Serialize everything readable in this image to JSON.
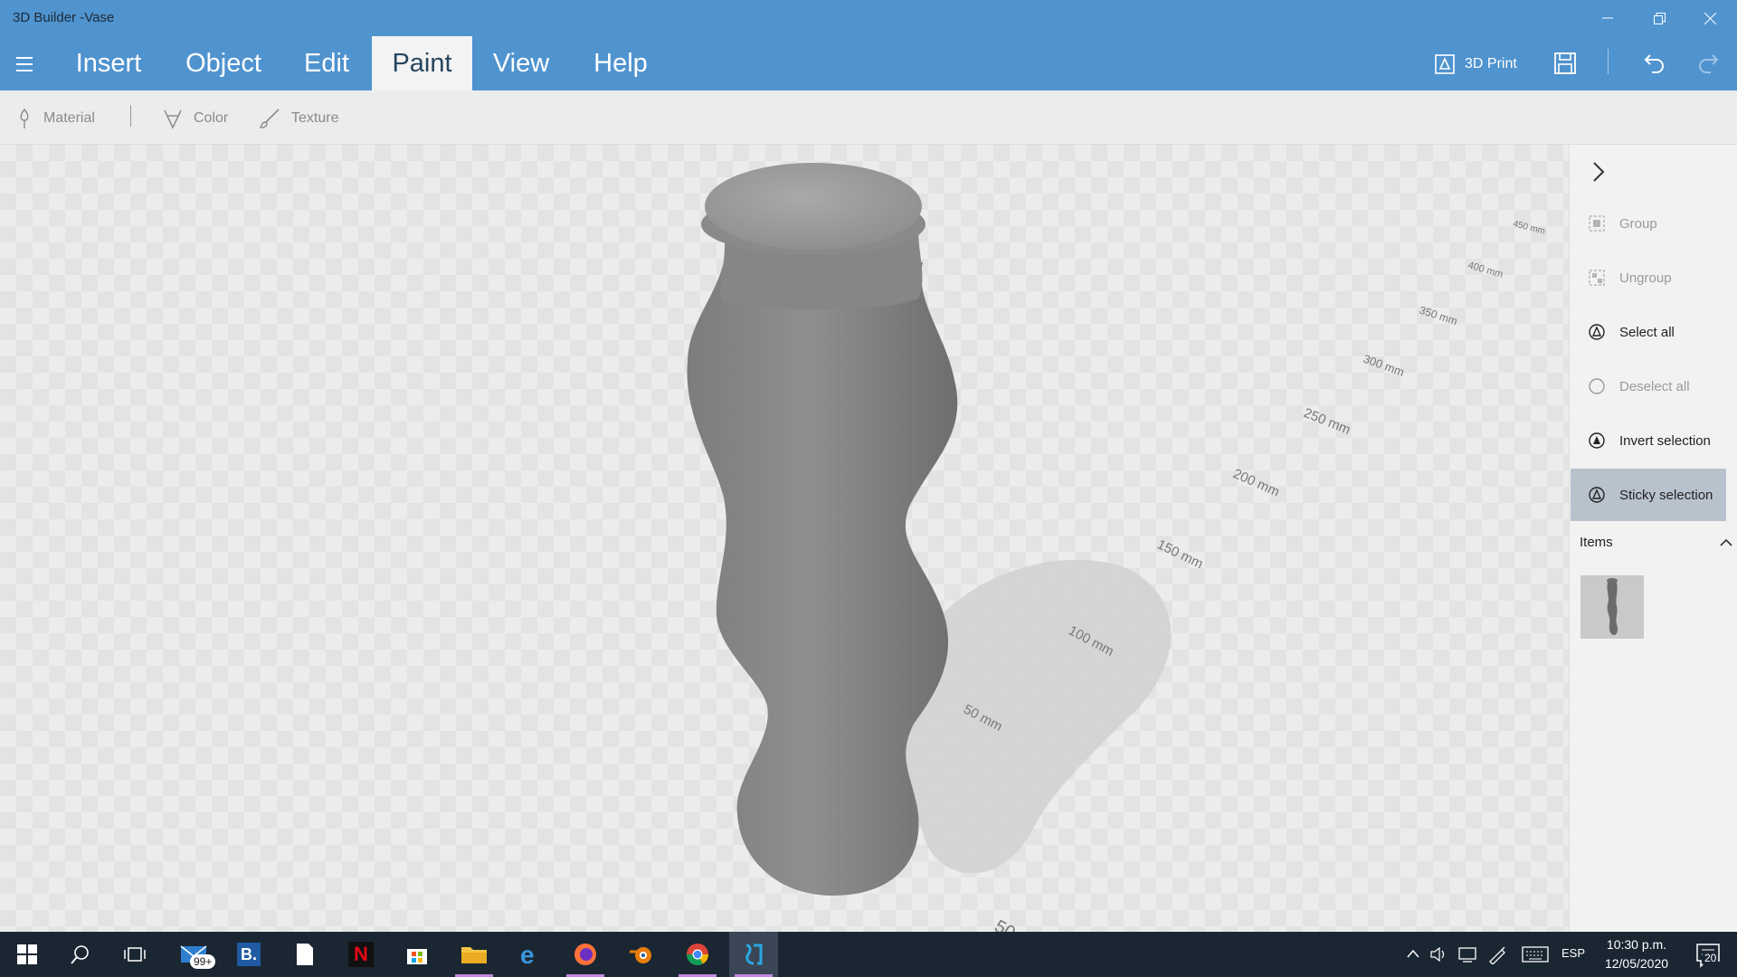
{
  "window": {
    "title": "3D Builder -Vase",
    "controls": [
      "minimize",
      "maximize",
      "close"
    ]
  },
  "menu": {
    "tabs": [
      {
        "label": "Insert",
        "active": false
      },
      {
        "label": "Object",
        "active": false
      },
      {
        "label": "Edit",
        "active": false
      },
      {
        "label": "Paint",
        "active": true
      },
      {
        "label": "View",
        "active": false
      },
      {
        "label": "Help",
        "active": false
      }
    ],
    "print_label": "3D Print"
  },
  "subtoolbar": {
    "material": "Material",
    "color": "Color",
    "texture": "Texture"
  },
  "viewport": {
    "ruler_labels": [
      "50 mm",
      "100 mm",
      "150 mm",
      "200 mm",
      "250 mm",
      "300 mm",
      "350 mm",
      "400 mm",
      "450 mm",
      "50"
    ],
    "object": "vase"
  },
  "panel": {
    "actions": [
      {
        "label": "Group",
        "enabled": false,
        "icon": "group-icon"
      },
      {
        "label": "Ungroup",
        "enabled": false,
        "icon": "ungroup-icon"
      },
      {
        "label": "Select all",
        "enabled": true,
        "icon": "select-all-icon"
      },
      {
        "label": "Deselect all",
        "enabled": false,
        "icon": "deselect-all-icon"
      },
      {
        "label": "Invert selection",
        "enabled": true,
        "icon": "invert-selection-icon"
      },
      {
        "label": "Sticky selection",
        "enabled": true,
        "active": true,
        "icon": "sticky-selection-icon"
      }
    ],
    "items_heading": "Items"
  },
  "taskbar": {
    "apps": [
      "start",
      "search",
      "task-view",
      "mail",
      "b-app",
      "file",
      "netflix",
      "store",
      "file-explorer",
      "edge",
      "firefox",
      "blender",
      "chrome",
      "3d-builder"
    ],
    "mail_badge": "99+",
    "language": "ESP",
    "time": "10:30 p.m.",
    "date": "12/05/2020",
    "notification_count": "20"
  },
  "colors": {
    "accent": "#4f93cf",
    "taskbar": "#1b2633",
    "panel_active": "#b8c2cd",
    "vase": "#8a8a8a"
  }
}
